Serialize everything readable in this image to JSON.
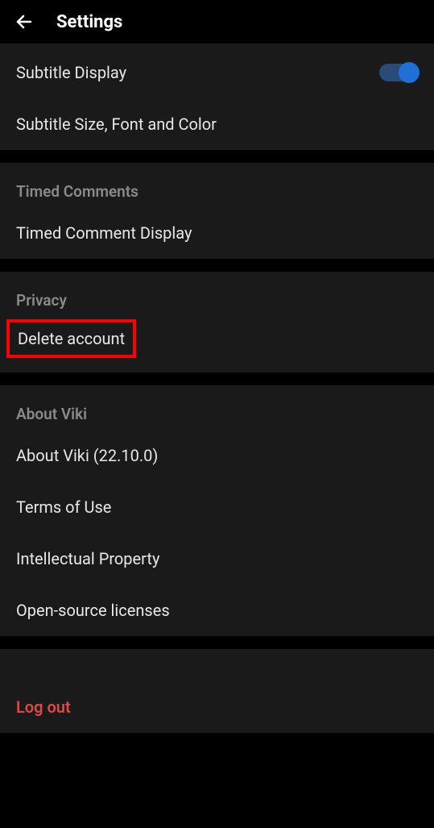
{
  "header": {
    "title": "Settings"
  },
  "subtitle_section": {
    "display_label": "Subtitle Display",
    "size_label": "Subtitle Size, Font and Color"
  },
  "timed_comments_section": {
    "header": "Timed Comments",
    "display_label": "Timed Comment Display"
  },
  "privacy_section": {
    "header": "Privacy",
    "delete_label": "Delete account"
  },
  "about_section": {
    "header": "About Viki",
    "about_label": "About Viki (22.10.0)",
    "terms_label": "Terms of Use",
    "ip_label": "Intellectual Property",
    "licenses_label": "Open-source licenses"
  },
  "logout_section": {
    "logout_label": "Log out"
  }
}
